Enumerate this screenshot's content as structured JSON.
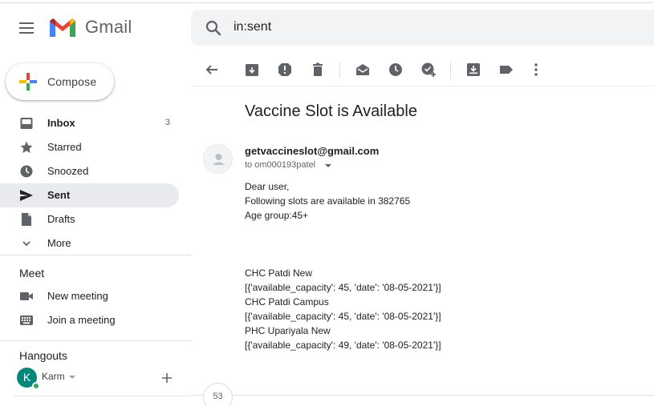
{
  "app": {
    "name": "Gmail"
  },
  "search": {
    "value": "in:sent"
  },
  "compose": {
    "label": "Compose"
  },
  "sidebar": {
    "items": [
      {
        "label": "Inbox",
        "count": "3",
        "icon": "inbox-icon"
      },
      {
        "label": "Starred",
        "icon": "star-icon"
      },
      {
        "label": "Snoozed",
        "icon": "clock-icon"
      },
      {
        "label": "Sent",
        "icon": "send-icon"
      },
      {
        "label": "Drafts",
        "icon": "draft-icon"
      },
      {
        "label": "More",
        "icon": "chevron-down-icon"
      }
    ]
  },
  "meet": {
    "title": "Meet",
    "items": [
      {
        "label": "New meeting",
        "icon": "videocam-icon"
      },
      {
        "label": "Join a meeting",
        "icon": "keyboard-icon"
      }
    ]
  },
  "hangouts": {
    "title": "Hangouts",
    "user_initial": "K",
    "user_name": "Karm"
  },
  "message": {
    "subject": "Vaccine Slot is Available",
    "sender": "getvaccineslot@gmail.com",
    "to": "to om000193patel",
    "lines": [
      "Dear user,",
      "Following slots are available in 382765",
      "Age group:45+",
      "CHC Patdi New",
      "[{'available_capacity': 45, 'date': '08-05-2021'}]",
      "CHC Patdi Campus",
      "[{'available_capacity': 45, 'date': '08-05-2021'}]",
      "PHC Upariyala New",
      "[{'available_capacity': 49, 'date': '08-05-2021'}]"
    ]
  },
  "thread": {
    "collapsed_count": "53"
  },
  "colors": {
    "active_bg": "#e8eaed",
    "icon": "#5f6368",
    "avatar": "#00897b",
    "online": "#34a853"
  }
}
